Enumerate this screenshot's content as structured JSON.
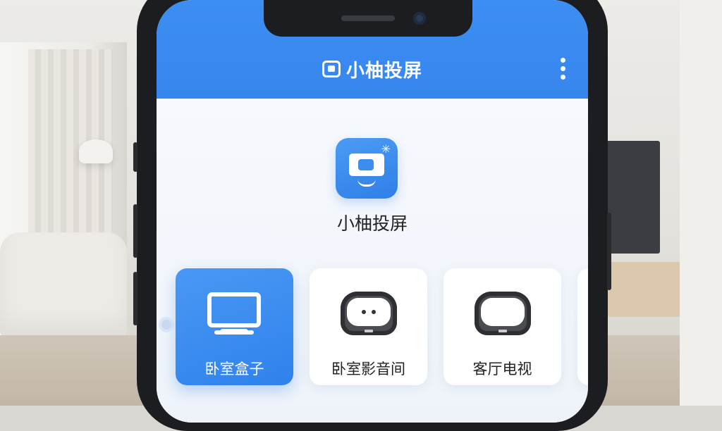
{
  "app": {
    "title": "小柚投屏",
    "name": "小柚投屏"
  },
  "header": {
    "menu_icon": "more-vertical-icon"
  },
  "devices": [
    {
      "label": "卧室盒子",
      "icon": "monitor-icon",
      "selected": true
    },
    {
      "label": "卧室影音间",
      "icon": "tv-box-icon",
      "selected": false
    },
    {
      "label": "客厅电视",
      "icon": "tv-box-icon",
      "selected": false
    }
  ],
  "colors": {
    "accent": "#3686ee",
    "background": "#f2f6fb"
  }
}
